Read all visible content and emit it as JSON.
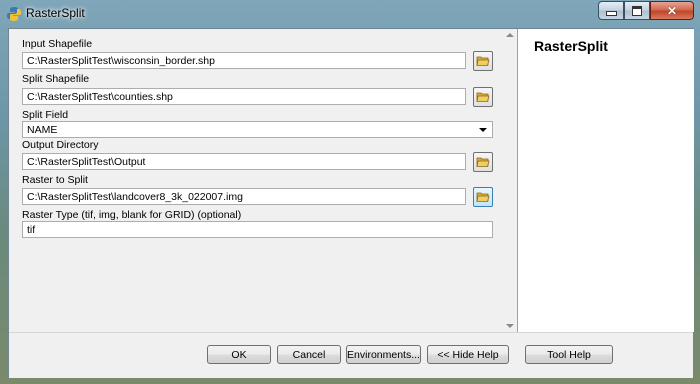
{
  "window": {
    "title": "RasterSplit",
    "icon": "python-script-icon"
  },
  "form": {
    "input_shapefile": {
      "label": "Input Shapefile",
      "value": "C:\\RasterSplitTest\\wisconsin_border.shp"
    },
    "split_shapefile": {
      "label": "Split Shapefile",
      "value": "C:\\RasterSplitTest\\counties.shp"
    },
    "split_field": {
      "label": "Split Field",
      "value": "NAME"
    },
    "output_directory": {
      "label": "Output Directory",
      "value": "C:\\RasterSplitTest\\Output"
    },
    "raster_to_split": {
      "label": "Raster to Split",
      "value": "C:\\RasterSplitTest\\landcover8_3k_022007.img"
    },
    "raster_type": {
      "label": "Raster Type (tif, img, blank for GRID) (optional)",
      "value": "tif"
    }
  },
  "help_panel": {
    "title": "RasterSplit"
  },
  "buttons": {
    "ok": "OK",
    "cancel": "Cancel",
    "environments": "Environments...",
    "hide_help": "<< Hide Help",
    "tool_help": "Tool Help"
  },
  "colors": {
    "close_button": "#c2452a",
    "folder_yellow": "#e8c04a"
  }
}
